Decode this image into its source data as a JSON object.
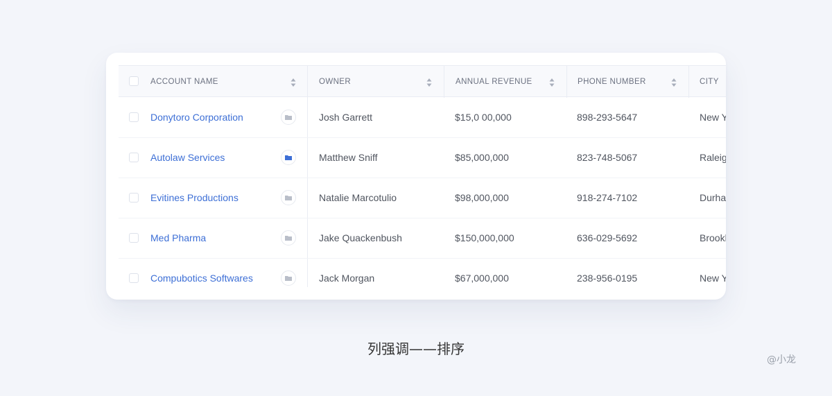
{
  "colors": {
    "background": "#f3f5fa",
    "card": "#ffffff",
    "link": "#3d6fd6",
    "text": "#50555f",
    "header_text": "#6b7180",
    "active_icon": "#3d6fd6",
    "inactive_icon": "#b9bec9"
  },
  "table": {
    "columns": [
      {
        "label": "ACCOUNT NAME",
        "sortable": true
      },
      {
        "label": "OWNER",
        "sortable": true
      },
      {
        "label": "ANNUAL REVENUE",
        "sortable": true
      },
      {
        "label": "PHONE NUMBER",
        "sortable": true
      },
      {
        "label": "CITY",
        "sortable": false
      }
    ],
    "rows": [
      {
        "account": "Donytoro Corporation",
        "icon": "folder-icon",
        "icon_active": false,
        "owner": "Josh Garrett",
        "revenue": "$15,0 00,000",
        "phone": "898-293-5647",
        "city": "New York"
      },
      {
        "account": "Autolaw Services",
        "icon": "folder-icon",
        "icon_active": true,
        "owner": "Matthew Sniff",
        "revenue": "$85,000,000",
        "phone": "823-748-5067",
        "city": "Raleigh"
      },
      {
        "account": "Evitines Productions",
        "icon": "folder-icon",
        "icon_active": false,
        "owner": "Natalie Marcotulio",
        "revenue": "$98,000,000",
        "phone": "918-274-7102",
        "city": "Durham"
      },
      {
        "account": "Med Pharma",
        "icon": "folder-icon",
        "icon_active": false,
        "owner": "Jake Quackenbush",
        "revenue": "$150,000,000",
        "phone": "636-029-5692",
        "city": "Brooklyn"
      },
      {
        "account": "Compubotics Softwares",
        "icon": "folder-icon",
        "icon_active": false,
        "owner": "Jack Morgan",
        "revenue": "$67,000,000",
        "phone": "238-956-0195",
        "city": "New York"
      }
    ]
  },
  "caption": "列强调——排序",
  "watermark": "@小龙"
}
